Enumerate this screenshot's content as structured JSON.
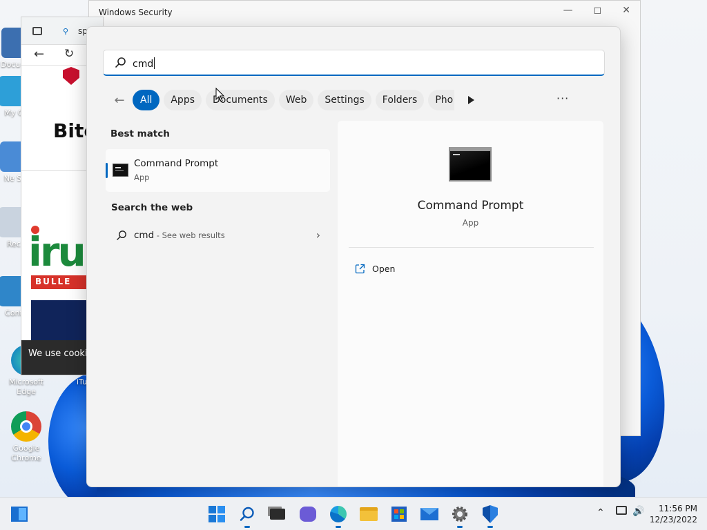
{
  "background_window": {
    "title": "Windows Security",
    "browser_address_fragment": "sp",
    "page_heading_fragment": "Bitc",
    "ad_text_fragment": "iru",
    "ad_sub_fragment": "BULLE",
    "cookie_fragment": "We use cookie"
  },
  "desktop_icons": [
    {
      "label": "Docu Sh"
    },
    {
      "label": "My C"
    },
    {
      "label": "Ne Sh"
    },
    {
      "label": "Rec"
    },
    {
      "label": "Cont"
    },
    {
      "label": "Microsoft Edge"
    },
    {
      "label": "iTun"
    },
    {
      "label": "Google Chrome"
    }
  ],
  "search": {
    "query": "cmd"
  },
  "filters": {
    "items": [
      "All",
      "Apps",
      "Documents",
      "Web",
      "Settings",
      "Folders",
      "Pho"
    ],
    "active": "All",
    "more_label": "···"
  },
  "best_match": {
    "heading": "Best match",
    "name": "Command Prompt",
    "type": "App"
  },
  "web": {
    "heading": "Search the web",
    "query": "cmd",
    "suffix": " - See web results"
  },
  "detail": {
    "name": "Command Prompt",
    "type": "App",
    "action_open": "Open"
  },
  "taskbar": {
    "time": "11:56 PM",
    "date": "12/23/2022"
  },
  "colors": {
    "accent": "#0067c0",
    "panel_bg": "#f3f3f3"
  }
}
